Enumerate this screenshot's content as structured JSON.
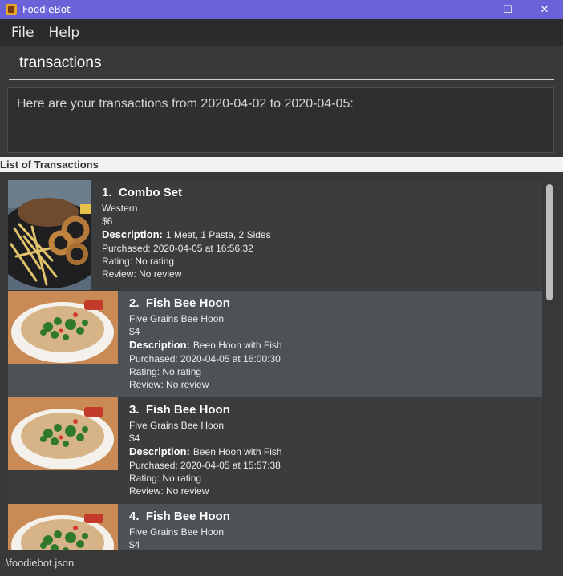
{
  "window": {
    "title": "FoodieBot",
    "minimize": "—",
    "maximize": "☐",
    "close": "✕"
  },
  "menu": {
    "file": "File",
    "help": "Help"
  },
  "command": {
    "value": "transactions"
  },
  "result": {
    "text": "Here are your transactions from 2020-04-02 to 2020-04-05:"
  },
  "list": {
    "header": "List of Transactions",
    "description_label": "Description:",
    "items": [
      {
        "index": "1.",
        "name": "Combo Set",
        "canteen": "Western",
        "price": "$6",
        "description": "1 Meat, 1 Pasta, 2 Sides",
        "purchased": "Purchased: 2020-04-05 at 16:56:32",
        "rating": "Rating: No rating",
        "review": "Review: No review",
        "image": "combo-set-photo"
      },
      {
        "index": "2.",
        "name": "Fish Bee Hoon",
        "canteen": "Five Grains Bee Hoon",
        "price": "$4",
        "description": "Been Hoon with Fish",
        "purchased": "Purchased: 2020-04-05 at 16:00:30",
        "rating": "Rating: No rating",
        "review": "Review: No review",
        "image": "fish-bee-hoon-photo"
      },
      {
        "index": "3.",
        "name": "Fish Bee Hoon",
        "canteen": "Five Grains Bee Hoon",
        "price": "$4",
        "description": "Been Hoon with Fish",
        "purchased": "Purchased: 2020-04-05 at 15:57:38",
        "rating": "Rating: No rating",
        "review": "Review: No review",
        "image": "fish-bee-hoon-photo"
      },
      {
        "index": "4.",
        "name": "Fish Bee Hoon",
        "canteen": "Five Grains Bee Hoon",
        "price": "$4",
        "image": "fish-bee-hoon-photo"
      }
    ]
  },
  "status": {
    "path": ".\\foodiebot.json"
  },
  "colors": {
    "titlebar": "#6a62d6",
    "menubar": "#2b2b2b",
    "panel": "#383838",
    "card_even": "#4d5256",
    "card_odd": "#3a3c3e"
  }
}
